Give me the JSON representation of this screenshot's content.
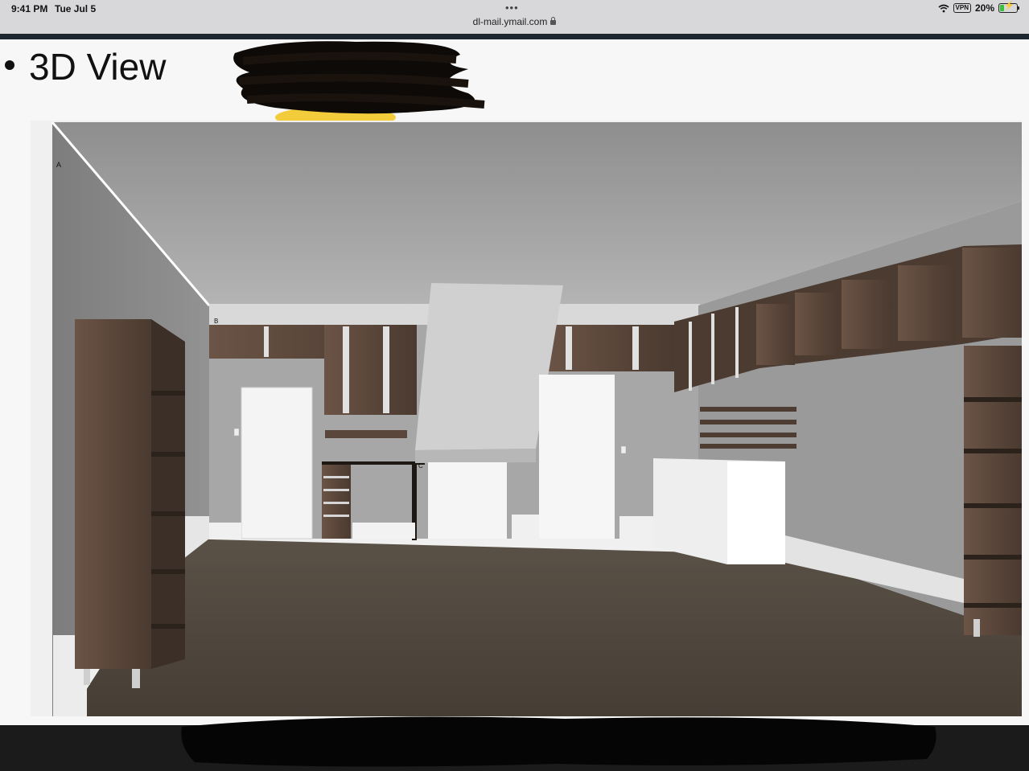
{
  "status_bar": {
    "time": "9:41 PM",
    "date": "Tue Jul 5",
    "url": "dl-mail.ymail.com",
    "vpn": "VPN",
    "battery": "20%",
    "battery_level": 0.2
  },
  "slide": {
    "title": "3D View",
    "marker_a": "A",
    "marker_b": "B",
    "marker_c": "C"
  },
  "colors": {
    "wall": "#8c8c8c",
    "ceiling": "#a9a9a9",
    "floor": "#4b433a",
    "cabinet_wood": "#5a463a",
    "white": "#f2f2f2",
    "redaction": "#0d0a08",
    "light_yellow": "#f2cc3a"
  }
}
